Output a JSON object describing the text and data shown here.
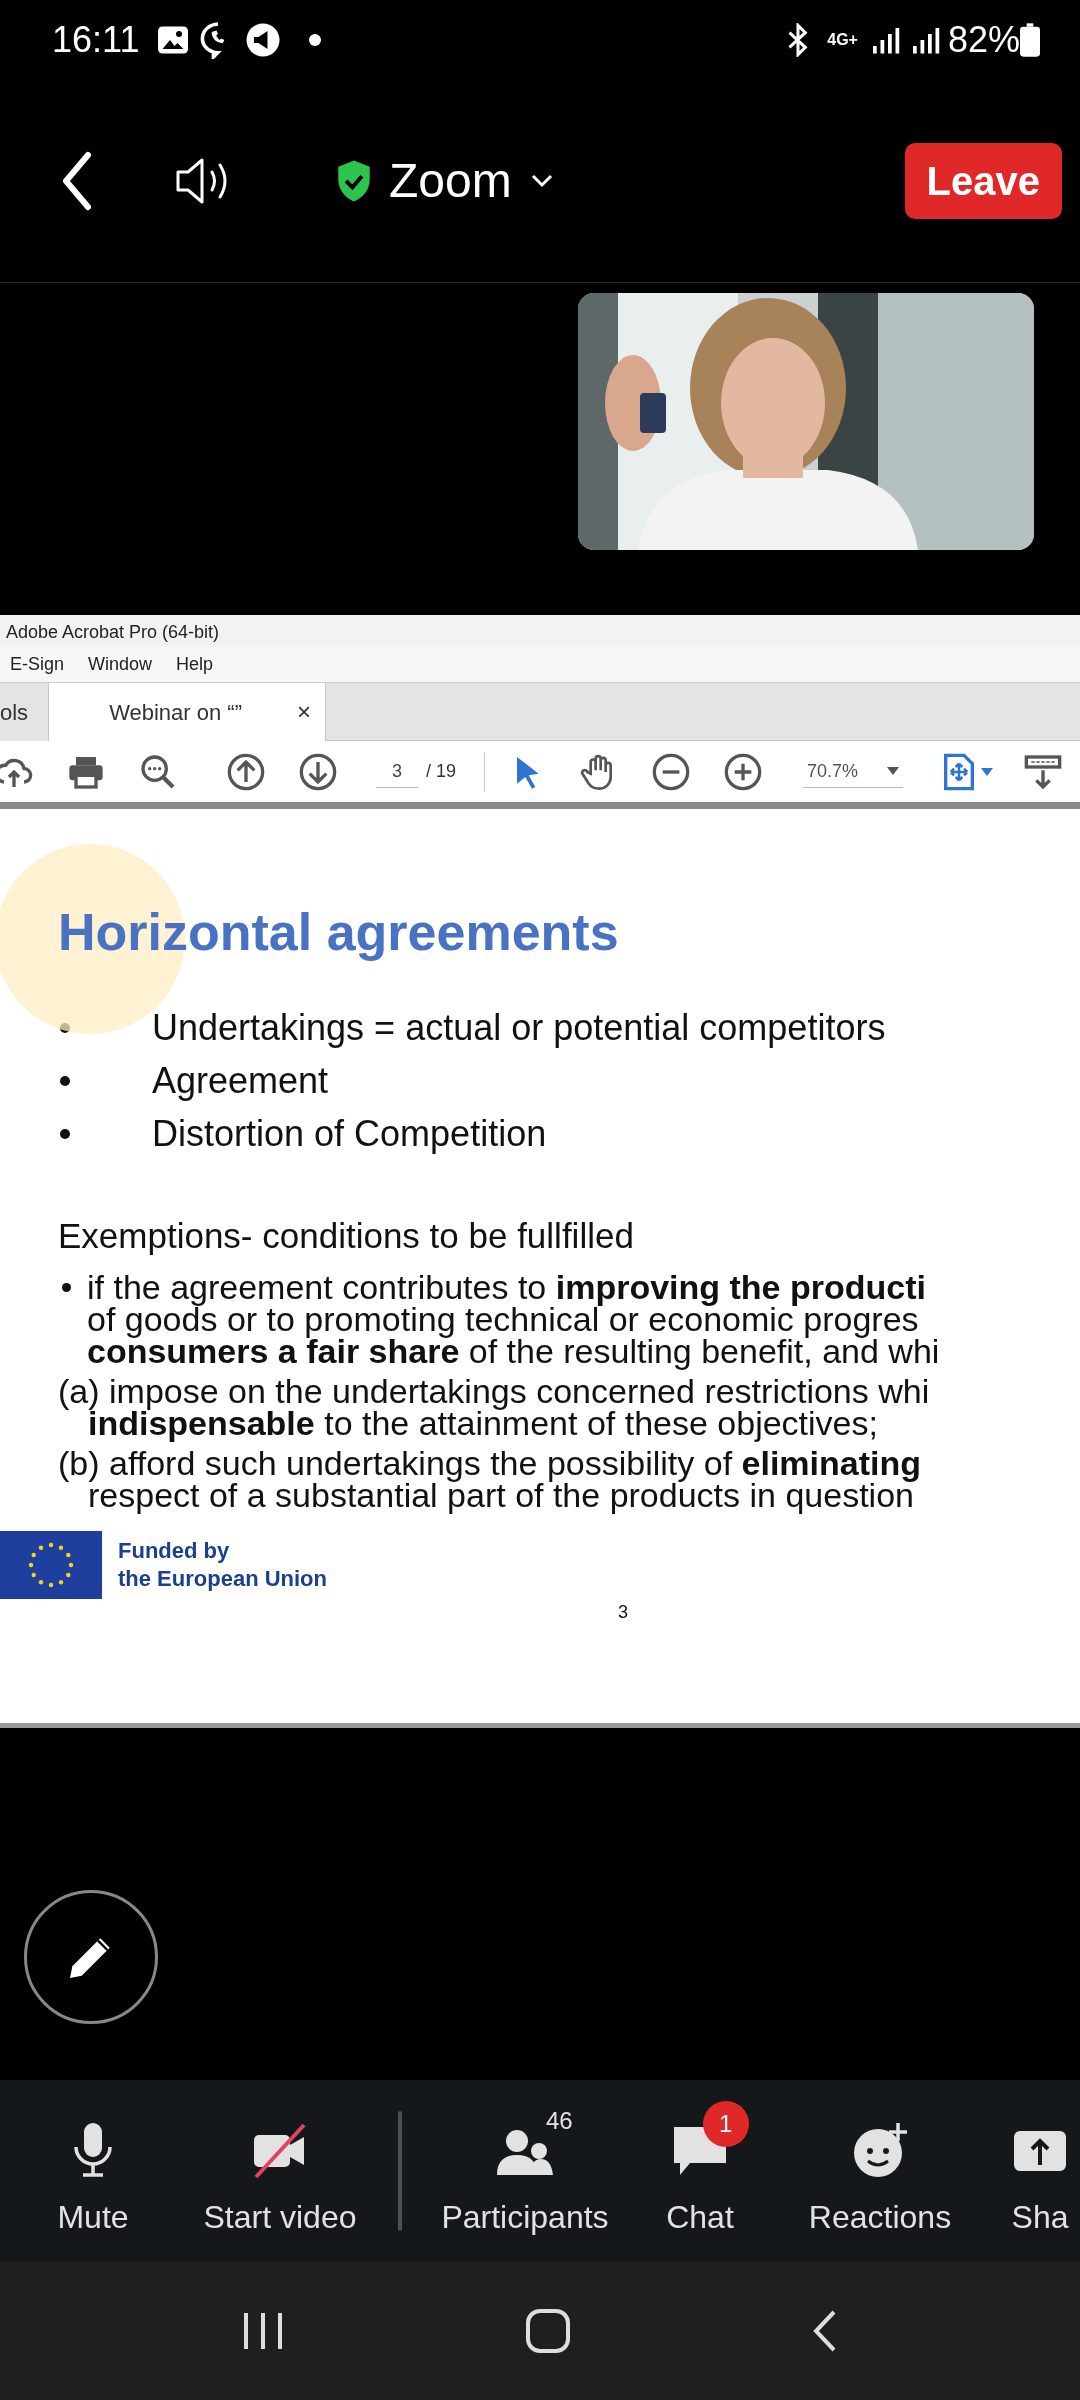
{
  "status_bar": {
    "time": "16:11",
    "network": "4G+",
    "battery": "82%"
  },
  "meeting_header": {
    "title": "Zoom",
    "leave_button": "Leave"
  },
  "shared_screen": {
    "app_title": "Adobe Acrobat Pro (64-bit)",
    "menu": [
      "E-Sign",
      "Window",
      "Help"
    ],
    "tabs": [
      {
        "label": "ols",
        "selected": false
      },
      {
        "label": "Webinar on “”",
        "selected": true,
        "close": "×"
      }
    ],
    "toolbar": {
      "page": "3",
      "page_total": "/ 19",
      "zoom": "70.7%",
      "tools": [
        {
          "kind": "select",
          "selected": true
        },
        {
          "kind": "hand",
          "selected": false
        }
      ]
    },
    "slide": {
      "title": "Horizontal agreements",
      "bullets": [
        "Undertakings = actual or potential competitors",
        "Agreement",
        "Distortion of Competition"
      ],
      "exemptions_heading": "Exemptions- conditions to be fullfilled",
      "conditions": [
        {
          "kind": "bullet",
          "lines": [
            "if the agreement contributes to **improving the producti**",
            "of goods or to promoting technical or economic progres",
            "**consumers a fair share** of the resulting benefit, and whi"
          ]
        },
        {
          "kind": "lettered",
          "lines": [
            "(a) impose on the undertakings concerned restrictions whi",
            "**indispensable** to the attainment of these objectives;"
          ]
        },
        {
          "kind": "lettered",
          "lines": [
            "(b) afford such undertakings the possibility of **eliminating**",
            "respect of a substantial part of the products in question"
          ]
        }
      ],
      "funder": [
        "Funded by",
        "the European Union"
      ],
      "page_number": "3"
    }
  },
  "controls": [
    {
      "kind": "mic",
      "label": "Mute"
    },
    {
      "kind": "video_off",
      "label": "Start video"
    },
    {
      "kind": "participants",
      "label": "Participants",
      "count": "46"
    },
    {
      "kind": "chat",
      "label": "Chat",
      "badge": "1"
    },
    {
      "kind": "reactions",
      "label": "Reactions"
    },
    {
      "kind": "share",
      "label": "Sha"
    }
  ]
}
